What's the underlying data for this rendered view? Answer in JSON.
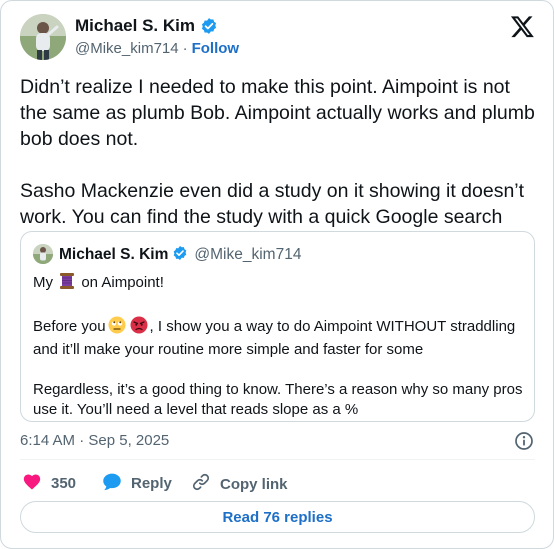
{
  "author": {
    "name": "Michael S. Kim",
    "handle": "@Mike_kim714",
    "separator": "·",
    "follow_label": "Follow"
  },
  "tweet": {
    "text": "Didn’t realize I needed to make this point. Aimpoint is not the same as plumb Bob. Aimpoint actually works and plumb bob does not.\n\nSasho Mackenzie even did a study on it showing it doesn’t work. You can find the study with a quick Google search"
  },
  "quoted": {
    "name": "Michael S. Kim",
    "handle": "@Mike_kim714",
    "line1_before": "My",
    "line1_after": "on Aimpoint!",
    "line2_before": "Before you",
    "line2_after": ", I show you a way to do Aimpoint WITHOUT straddling",
    "line3": "and it’ll make your routine more simple and faster for some",
    "line4": "Regardless, it’s a good thing to know. There’s a reason why so many pros",
    "line5": "use it. You’ll need a level that reads slope as a %"
  },
  "timestamp": "6:14 AM · Sep 5, 2025",
  "actions": {
    "likes_count": "350",
    "reply_label": "Reply",
    "copy_link_label": "Copy link"
  },
  "read_replies_label": "Read 76 replies",
  "colors": {
    "like": "#f91880",
    "reply": "#1d9bf0",
    "link": "#1d6fc8",
    "verified": "#1d9bf0",
    "secondary_text": "#536471"
  },
  "icons": [
    "verified-badge-icon",
    "x-logo-icon",
    "info-icon",
    "heart-icon",
    "reply-bubble-icon",
    "link-icon",
    "spool-of-thread-emoji",
    "rolling-eyes-emoji",
    "angry-face-emoji"
  ]
}
